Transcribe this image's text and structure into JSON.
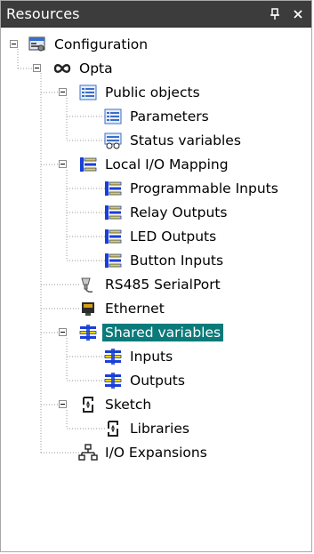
{
  "panel": {
    "title": "Resources",
    "pin_icon": "pin-icon",
    "close_icon": "close-icon"
  },
  "tree": {
    "configuration": "Configuration",
    "opta": "Opta",
    "public_objects": "Public objects",
    "parameters": "Parameters",
    "status_variables": "Status variables",
    "local_io_mapping": "Local I/O Mapping",
    "programmable_inputs": "Programmable Inputs",
    "relay_outputs": "Relay Outputs",
    "led_outputs": "LED Outputs",
    "button_inputs": "Button Inputs",
    "rs485": "RS485 SerialPort",
    "ethernet": "Ethernet",
    "shared_variables": "Shared variables",
    "inputs": "Inputs",
    "outputs": "Outputs",
    "sketch": "Sketch",
    "libraries": "Libraries",
    "io_expansions": "I/O Expansions"
  },
  "selected": "Shared variables",
  "colors": {
    "titlebar": "#3c3c3c",
    "selection": "#0b7a7a",
    "icon_blue": "#1a3fd6",
    "icon_yellow": "#f2d200"
  }
}
